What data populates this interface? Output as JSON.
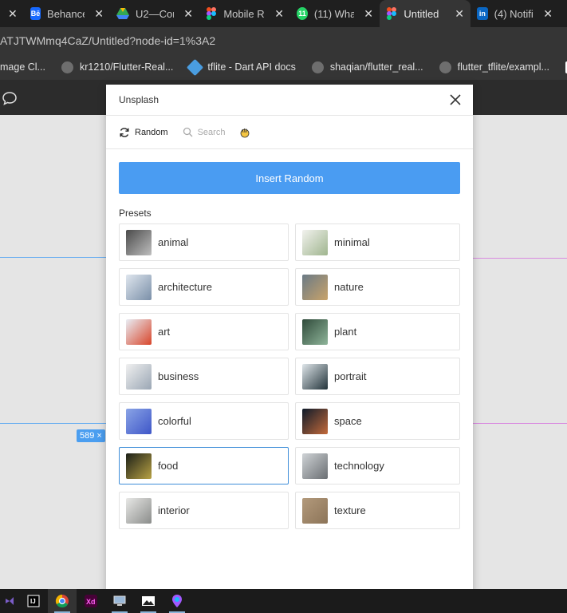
{
  "browser": {
    "tabs": [
      {
        "label": "",
        "favicon": "close-only",
        "color": "#1f1f1f"
      },
      {
        "label": "Behance",
        "favicon": "behance-icon",
        "color": "#1769ff"
      },
      {
        "label": "U2—Con",
        "favicon": "google-drive-icon",
        "color": "#34a853"
      },
      {
        "label": "Mobile R",
        "favicon": "figma-icon",
        "color": "#f24e1e"
      },
      {
        "label": "(11) Wha",
        "favicon": "whatsapp-icon",
        "color": "#25d366"
      },
      {
        "label": "Untitled",
        "favicon": "figma-icon",
        "color": "#f24e1e"
      },
      {
        "label": "(4) Notifi",
        "favicon": "linkedin-icon",
        "color": "#0a66c2"
      }
    ],
    "url": "ATJTWMmq4CaZ/Untitled?node-id=1%3A2",
    "bookmarks": [
      {
        "label": "mage Cl...",
        "icon": "none"
      },
      {
        "label": "kr1210/Flutter-Real...",
        "icon": "github-icon"
      },
      {
        "label": "tflite - Dart API docs",
        "icon": "dart-icon"
      },
      {
        "label": "shaqian/flutter_real...",
        "icon": "github-icon"
      },
      {
        "label": "flutter_tflite/exampl...",
        "icon": "github-icon"
      },
      {
        "label": "B",
        "icon": "medium-icon"
      }
    ]
  },
  "canvas": {
    "size_badge": "589 ×"
  },
  "dialog": {
    "title": "Unsplash",
    "tabs": [
      {
        "label": "Random",
        "icon": "refresh-icon",
        "active": true
      },
      {
        "label": "Search",
        "icon": "search-icon",
        "active": false
      },
      {
        "label": "",
        "icon": "hand-emoji-icon",
        "active": false
      }
    ],
    "insert_button": "Insert Random",
    "presets_label": "Presets",
    "presets": [
      {
        "label": "animal",
        "thumb": [
          "#4a4a4a",
          "#bfbfbf"
        ]
      },
      {
        "label": "minimal",
        "thumb": [
          "#f2f2ee",
          "#9fb58e"
        ]
      },
      {
        "label": "architecture",
        "thumb": [
          "#dfe6ee",
          "#7a8fa8"
        ]
      },
      {
        "label": "nature",
        "thumb": [
          "#6a7a86",
          "#c9a36a"
        ]
      },
      {
        "label": "art",
        "thumb": [
          "#e9eef5",
          "#d8452a"
        ]
      },
      {
        "label": "plant",
        "thumb": [
          "#2f4a3a",
          "#8fb59a"
        ]
      },
      {
        "label": "business",
        "thumb": [
          "#f0f0f0",
          "#9aa6b4"
        ]
      },
      {
        "label": "portrait",
        "thumb": [
          "#dfe6ea",
          "#22333a"
        ]
      },
      {
        "label": "colorful",
        "thumb": [
          "#8aa4e6",
          "#3e56c8"
        ]
      },
      {
        "label": "space",
        "thumb": [
          "#0d1a2a",
          "#c46a3a"
        ]
      },
      {
        "label": "food",
        "thumb": [
          "#1b1f18",
          "#b8a244"
        ],
        "selected": true
      },
      {
        "label": "technology",
        "thumb": [
          "#cfd3d6",
          "#6a6e72"
        ]
      },
      {
        "label": "interior",
        "thumb": [
          "#e8e8e6",
          "#8a8c8a"
        ]
      },
      {
        "label": "texture",
        "thumb": [
          "#b39a7c",
          "#8c7458"
        ]
      }
    ]
  },
  "taskbar": {
    "icons": [
      "visual-studio-icon",
      "intellij-icon",
      "chrome-icon",
      "adobe-xd-icon",
      "computer-icon",
      "photos-icon",
      "figma-taskbar-icon"
    ]
  },
  "colors": {
    "accent": "#4a9cf2",
    "selected_border": "#3e8ed8",
    "frame_blue": "#6aaef0",
    "frame_pink": "#d98be0"
  }
}
